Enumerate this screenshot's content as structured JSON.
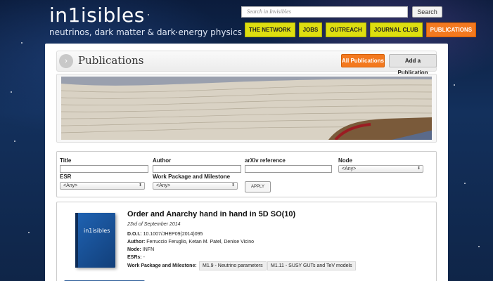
{
  "header": {
    "logo_text": "in1isibles",
    "tagline": "neutrinos, dark matter & dark energy physics",
    "search": {
      "placeholder": "Search in Invisibles",
      "button_label": "Search"
    },
    "nav": [
      {
        "label": "THE NETWORK",
        "active": false
      },
      {
        "label": "JOBS",
        "active": false
      },
      {
        "label": "OUTREACH",
        "active": false
      },
      {
        "label": "JOURNAL CLUB",
        "active": false
      },
      {
        "label": "PUBLICATIONS",
        "active": true
      }
    ]
  },
  "page": {
    "title": "Publications",
    "arrow_glyph": "›",
    "all_button": "All Publications",
    "add_button": "Add a Publication"
  },
  "filters": {
    "title_label": "Title",
    "author_label": "Author",
    "arxiv_label": "arXiv reference",
    "node_label": "Node",
    "node_value": "<Any>",
    "esr_label": "ESR",
    "esr_value": "<Any>",
    "wp_label": "Work Package and Milestone",
    "wp_value": "<Any>",
    "apply_label": "APPLY"
  },
  "publication": {
    "cover_text": "in1isibles",
    "title": "Order and Anarchy hand in hand in 5D SO(10)",
    "date": "23rd of September 2014",
    "doi_label": "D.O.I.:",
    "doi": "10.1007/JHEP09(2014)095",
    "author_label": "Author:",
    "authors": "Ferruccio Feruglio, Ketan M. Patel, Denise Vicino",
    "node_label": "Node:",
    "node": "INFN",
    "esrs_label": "ESRs:",
    "esrs": "-",
    "wp_label": "Work Package and Milestone:",
    "milestones": [
      "M1.9 - Neutrino parameters",
      "M1.11 - SUSY GUTs and TeV models"
    ]
  },
  "colors": {
    "nav_yellow": "#dede10",
    "accent_orange": "#f3791f",
    "cover_blue": "#1f63b3"
  }
}
